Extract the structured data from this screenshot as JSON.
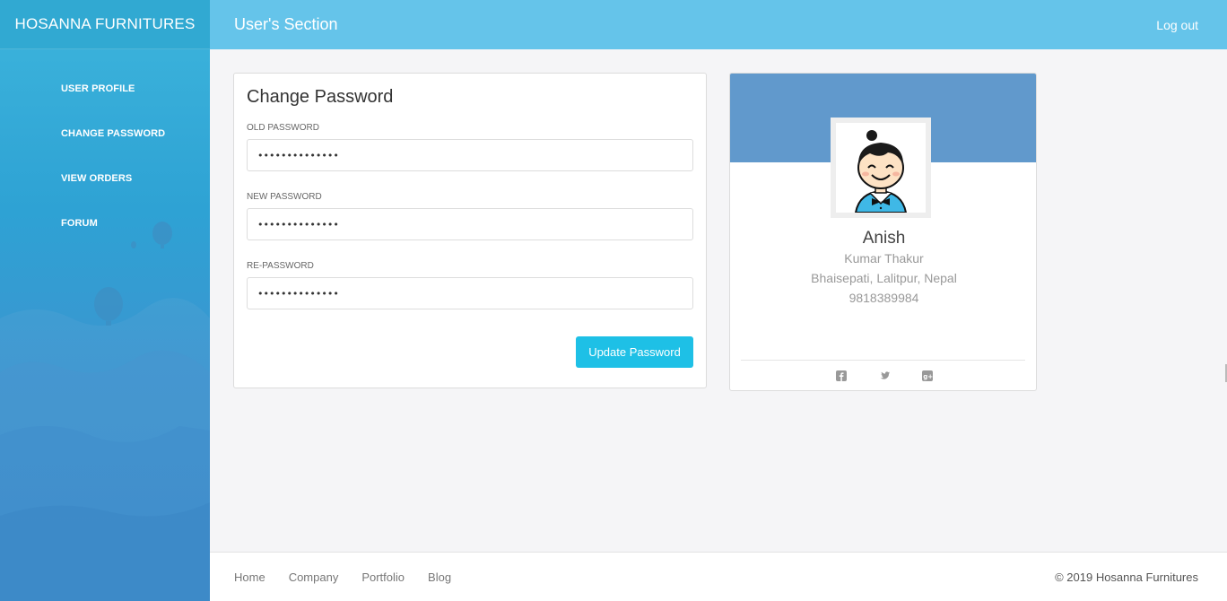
{
  "brand": "HOSANNA FURNITURES",
  "sidebar": {
    "items": [
      {
        "label": "USER PROFILE"
      },
      {
        "label": "CHANGE PASSWORD"
      },
      {
        "label": "VIEW ORDERS"
      },
      {
        "label": "FORUM"
      }
    ]
  },
  "header": {
    "title": "User's Section",
    "logout": "Log out"
  },
  "change_password": {
    "title": "Change Password",
    "old_label": "OLD PASSWORD",
    "old_value": "••••••••••••••",
    "new_label": "NEW PASSWORD",
    "new_value": "••••••••••••••",
    "re_label": "RE-PASSWORD",
    "re_value": "••••••••••••••",
    "button": "Update Password"
  },
  "profile": {
    "name": "Anish",
    "surname": "Kumar Thakur",
    "address": "Bhaisepati, Lalitpur, Nepal",
    "phone": "9818389984",
    "social": [
      "facebook-icon",
      "twitter-icon",
      "google-plus-icon"
    ]
  },
  "footer": {
    "links": [
      {
        "label": "Home"
      },
      {
        "label": "Company"
      },
      {
        "label": "Portfolio"
      },
      {
        "label": "Blog"
      }
    ],
    "copyright": "© 2019 Hosanna Furnitures"
  },
  "colors": {
    "topbar": "#65c4ea",
    "sidebar": "#31a9d2",
    "button": "#1ec0e6",
    "profile_banner": "#6199cc"
  }
}
